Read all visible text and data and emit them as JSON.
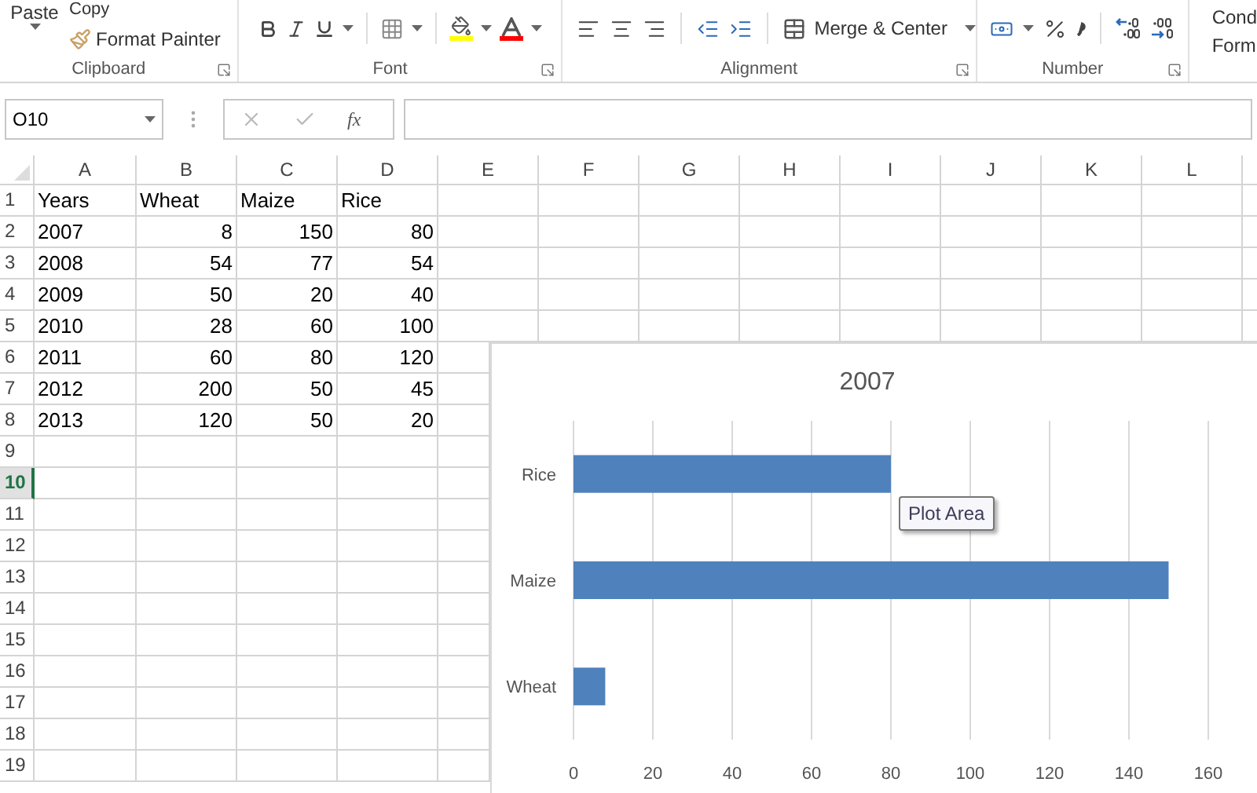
{
  "ribbon": {
    "clipboard": {
      "paste": "Paste",
      "copy": "Copy",
      "format_painter": "Format Painter",
      "label": "Clipboard"
    },
    "font": {
      "label": "Font"
    },
    "alignment": {
      "merge_center": "Merge & Center",
      "label": "Alignment"
    },
    "number": {
      "label": "Number"
    },
    "styles": {
      "conditional_formatting": [
        "Cond",
        "Form"
      ]
    }
  },
  "formula_bar": {
    "name_box": "O10",
    "function_label": "fx"
  },
  "sheet": {
    "columns": [
      "A",
      "B",
      "C",
      "D",
      "E",
      "F",
      "G",
      "H",
      "I",
      "J",
      "K",
      "L"
    ],
    "rows": [
      {
        "header": "1",
        "selected": false,
        "cells": [
          {
            "kind": "text",
            "text": "Years"
          },
          {
            "kind": "text",
            "text": "Wheat"
          },
          {
            "kind": "text",
            "text": "Maize"
          },
          {
            "kind": "text",
            "text": "Rice"
          }
        ]
      },
      {
        "header": "2",
        "selected": false,
        "cells": [
          {
            "kind": "text",
            "text": "2007"
          },
          {
            "kind": "number",
            "text": "8"
          },
          {
            "kind": "number",
            "text": "150"
          },
          {
            "kind": "number",
            "text": "80"
          }
        ]
      },
      {
        "header": "3",
        "selected": false,
        "cells": [
          {
            "kind": "text",
            "text": "2008"
          },
          {
            "kind": "number",
            "text": "54"
          },
          {
            "kind": "number",
            "text": "77"
          },
          {
            "kind": "number",
            "text": "54"
          }
        ]
      },
      {
        "header": "4",
        "selected": false,
        "cells": [
          {
            "kind": "text",
            "text": "2009"
          },
          {
            "kind": "number",
            "text": "50"
          },
          {
            "kind": "number",
            "text": "20"
          },
          {
            "kind": "number",
            "text": "40"
          }
        ]
      },
      {
        "header": "5",
        "selected": false,
        "cells": [
          {
            "kind": "text",
            "text": "2010"
          },
          {
            "kind": "number",
            "text": "28"
          },
          {
            "kind": "number",
            "text": "60"
          },
          {
            "kind": "number",
            "text": "100"
          }
        ]
      },
      {
        "header": "6",
        "selected": false,
        "cells": [
          {
            "kind": "text",
            "text": "2011"
          },
          {
            "kind": "number",
            "text": "60"
          },
          {
            "kind": "number",
            "text": "80"
          },
          {
            "kind": "number",
            "text": "120"
          }
        ]
      },
      {
        "header": "7",
        "selected": false,
        "cells": [
          {
            "kind": "text",
            "text": "2012"
          },
          {
            "kind": "number",
            "text": "200"
          },
          {
            "kind": "number",
            "text": "50"
          },
          {
            "kind": "number",
            "text": "45"
          }
        ]
      },
      {
        "header": "8",
        "selected": false,
        "cells": [
          {
            "kind": "text",
            "text": "2013"
          },
          {
            "kind": "number",
            "text": "120"
          },
          {
            "kind": "number",
            "text": "50"
          },
          {
            "kind": "number",
            "text": "20"
          }
        ]
      },
      {
        "header": "9",
        "selected": false,
        "cells": []
      },
      {
        "header": "10",
        "selected": true,
        "cells": []
      },
      {
        "header": "11",
        "selected": false,
        "cells": []
      },
      {
        "header": "12",
        "selected": false,
        "cells": []
      },
      {
        "header": "13",
        "selected": false,
        "cells": []
      },
      {
        "header": "14",
        "selected": false,
        "cells": []
      },
      {
        "header": "15",
        "selected": false,
        "cells": []
      },
      {
        "header": "16",
        "selected": false,
        "cells": []
      },
      {
        "header": "17",
        "selected": false,
        "cells": []
      },
      {
        "header": "18",
        "selected": false,
        "cells": []
      },
      {
        "header": "19",
        "selected": false,
        "cells": []
      }
    ]
  },
  "chart": {
    "tooltip": "Plot Area",
    "chart_data": {
      "type": "bar",
      "orientation": "horizontal",
      "title": "2007",
      "grid": true,
      "categories": [
        "Rice",
        "Maize",
        "Wheat"
      ],
      "series": [
        {
          "color": "#4f81bd",
          "values": [
            80,
            150,
            8
          ]
        }
      ],
      "xlim": [
        0,
        160
      ],
      "xticks": [
        0,
        20,
        40,
        60,
        80,
        100,
        120,
        140,
        160
      ]
    }
  }
}
